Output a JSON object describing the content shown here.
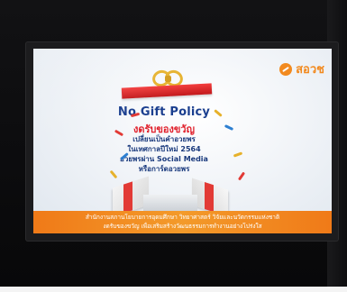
{
  "brand": {
    "name": "สอวช",
    "color": "#f28a1f"
  },
  "poster": {
    "title": "No Gift Policy",
    "subtitle": "งดรับของขวัญ",
    "lines": [
      "เปลี่ยนเป็นคำอวยพร",
      "ในเทศกาลปีใหม่ 2564",
      "อวยพรผ่าน Social Media",
      "หรือการ์ดอวยพร"
    ],
    "title_color": "#1b3f8f",
    "subtitle_color": "#e0212c"
  },
  "banner": {
    "line1": "สำนักงานสภานโยบายการอุดมศึกษา วิทยาศาสตร์ วิจัยและนวัตกรรมแห่งชาติ",
    "line2": "งดรับของขวัญ เพื่อเสริมสร้างวัฒนธรรมการทำงานอย่างโปร่งใส",
    "color": "#f07a18"
  }
}
